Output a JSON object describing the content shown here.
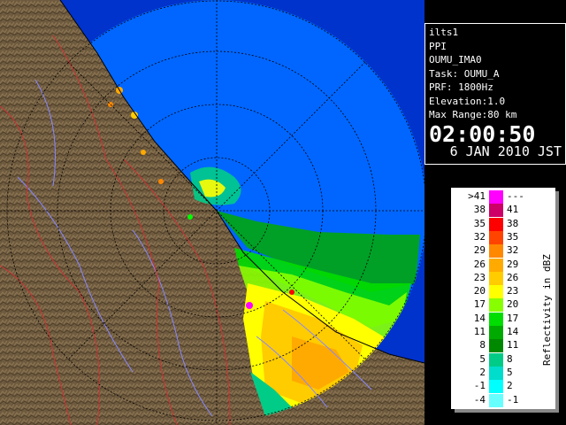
{
  "info": {
    "station": "ilts1",
    "mode": "PPI",
    "scan_name": "OUMU_IMA0",
    "task": "Task: OUMU_A",
    "prf": "PRF: 1800Hz",
    "elevation": "Elevation:1.0",
    "max_range": "Max Range:80 km",
    "clock": "02:00:50",
    "date": " 6 JAN 2010 JST"
  },
  "legend": {
    "title": "Reflectivity in dBZ",
    "rows": [
      {
        "lo": ">41",
        "hi": "---",
        "color": "#ff00ff"
      },
      {
        "lo": "38",
        "hi": "41",
        "color": "#cc0066"
      },
      {
        "lo": "35",
        "hi": "38",
        "color": "#ff0000"
      },
      {
        "lo": "32",
        "hi": "35",
        "color": "#ff4400"
      },
      {
        "lo": "29",
        "hi": "32",
        "color": "#ff8800"
      },
      {
        "lo": "26",
        "hi": "29",
        "color": "#ffaa00"
      },
      {
        "lo": "23",
        "hi": "26",
        "color": "#ffcc00"
      },
      {
        "lo": "20",
        "hi": "23",
        "color": "#ffff00"
      },
      {
        "lo": "17",
        "hi": "20",
        "color": "#88ff00"
      },
      {
        "lo": "14",
        "hi": "17",
        "color": "#00dd00"
      },
      {
        "lo": "11",
        "hi": "14",
        "color": "#00aa00"
      },
      {
        "lo": "8",
        "hi": "11",
        "color": "#008800"
      },
      {
        "lo": "5",
        "hi": "8",
        "color": "#00cc88"
      },
      {
        "lo": "2",
        "hi": "5",
        "color": "#00ddcc"
      },
      {
        "lo": "-1",
        "hi": "2",
        "color": "#00ffff"
      },
      {
        "lo": "-4",
        "hi": "-1",
        "color": "#66ffff"
      }
    ]
  },
  "colors": {
    "sea": "#0066ff",
    "sea_outside": "#0033cc",
    "land": "#6e5a3e",
    "rivers": "#8888ff",
    "borders": "#cc3333",
    "range_rings": "#000000"
  },
  "icons": {
    "radar_display": "radar-ppi-display"
  }
}
